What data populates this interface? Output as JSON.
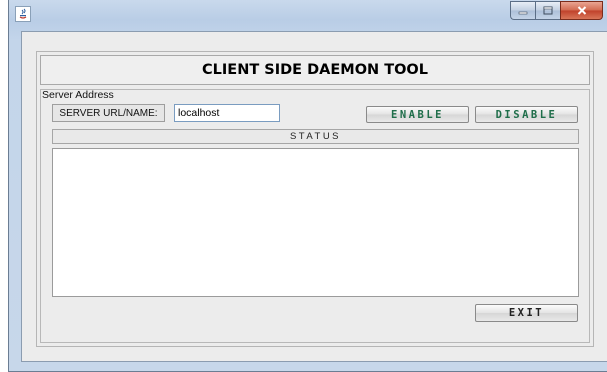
{
  "window": {
    "title": "",
    "icon": "java-icon",
    "controls": {
      "minimize_icon": "minimize-icon",
      "maximize_icon": "maximize-icon",
      "close_icon": "close-icon"
    }
  },
  "header": {
    "title": "CLIENT SIDE DAEMON TOOL"
  },
  "server": {
    "section_label": "Server Address",
    "url_label": "SERVER URL/NAME:",
    "url_value": "localhost",
    "enable_label": "ENABLE",
    "disable_label": "DISABLE"
  },
  "status": {
    "label": "STATUS",
    "text": ""
  },
  "footer": {
    "exit_label": "EXIT"
  },
  "colors": {
    "enable_text": "#1f6e4a",
    "disable_text": "#1f6e4a",
    "close_button": "#c94a30",
    "panel_bg": "#ececec"
  }
}
